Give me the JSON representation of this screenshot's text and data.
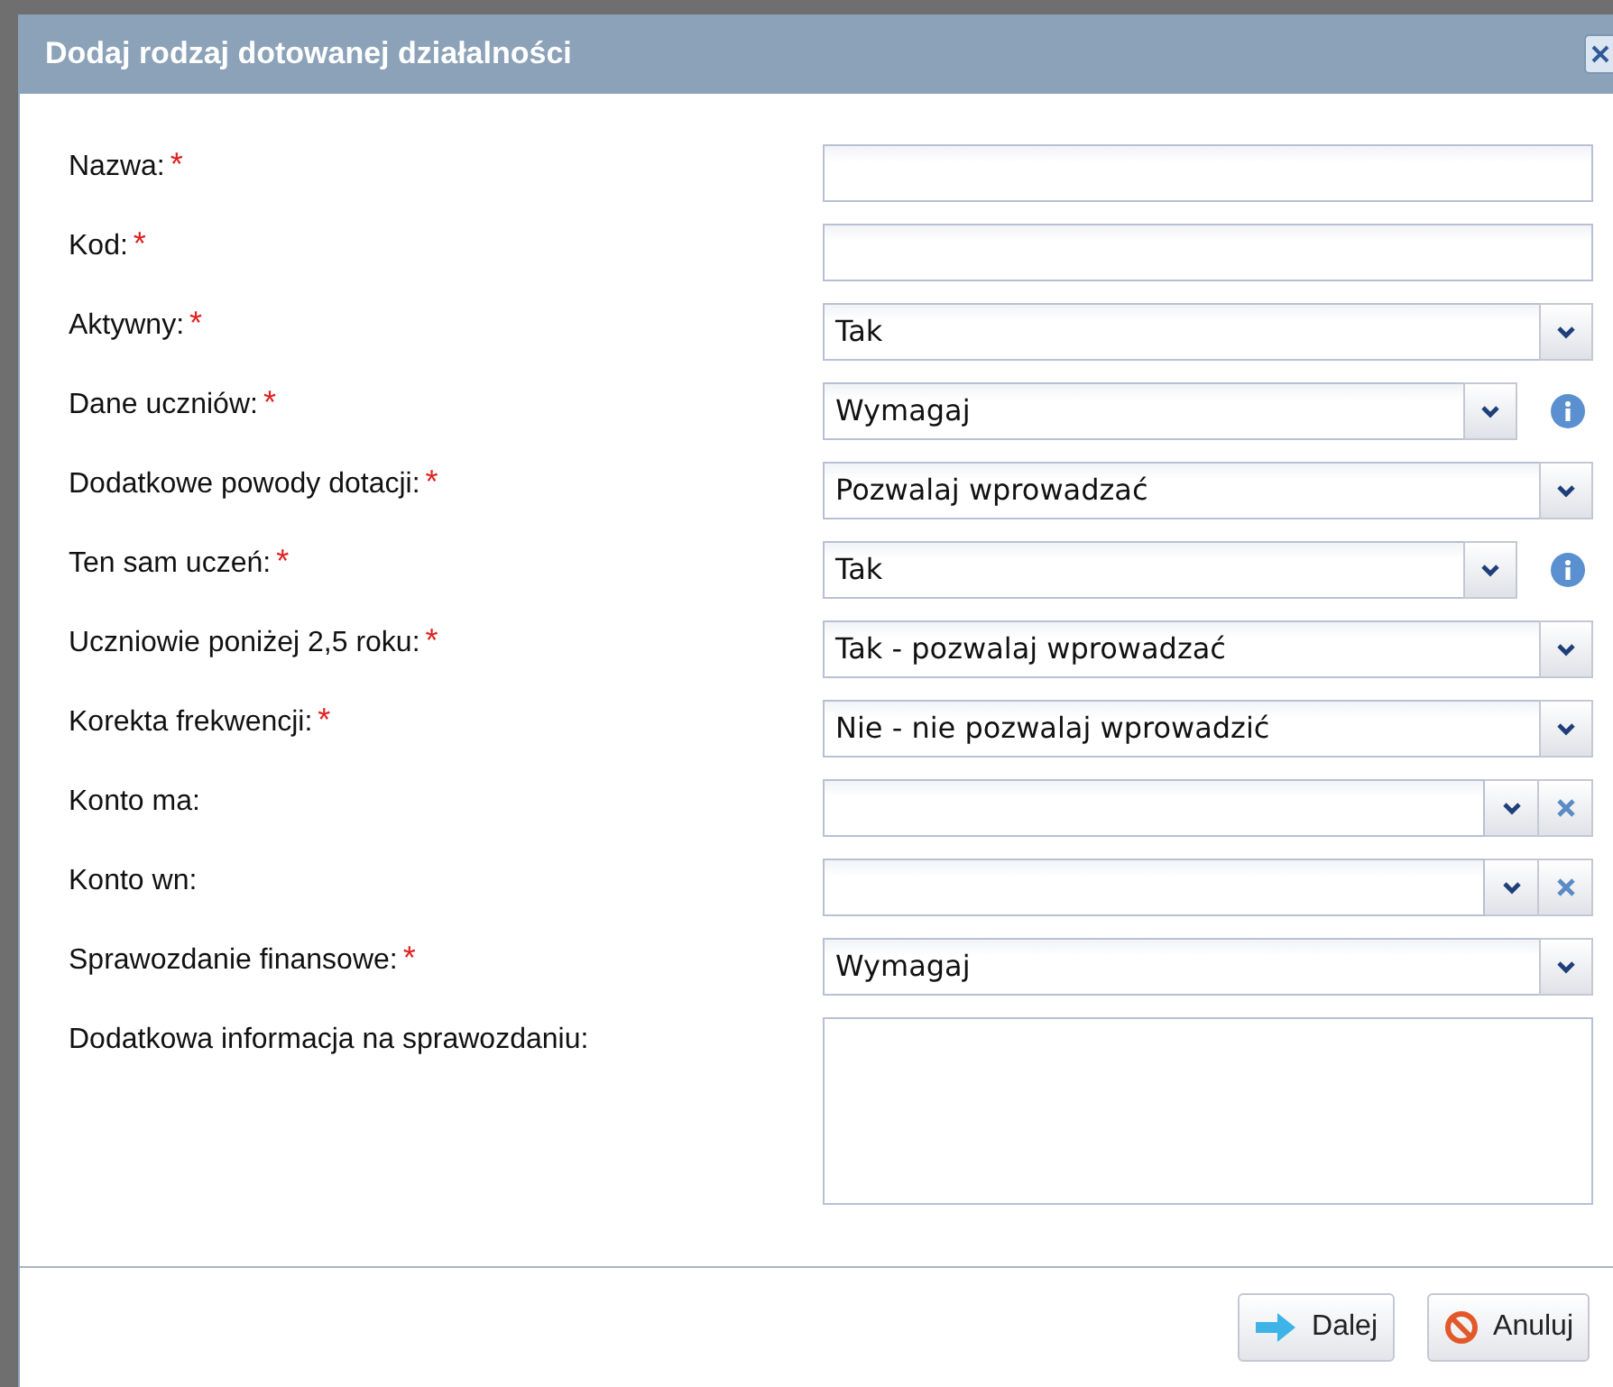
{
  "dialog": {
    "title": "Dodaj rodzaj dotowanej działalności"
  },
  "fields": [
    {
      "kind": "text",
      "label": "Nazwa:",
      "asterisk": "*"
    },
    {
      "kind": "text",
      "label": "Kod:",
      "asterisk": "*"
    },
    {
      "kind": "select",
      "label": "Aktywny:",
      "asterisk": "*",
      "value": "Tak"
    },
    {
      "kind": "select_info",
      "label": "Dane uczniów:",
      "asterisk": "*",
      "value": "Wymagaj"
    },
    {
      "kind": "select",
      "label": "Dodatkowe powody dotacji:",
      "asterisk": "*",
      "value": "Pozwalaj wprowadzać"
    },
    {
      "kind": "select_info",
      "label": "Ten sam uczeń:",
      "asterisk": "*",
      "value": "Tak"
    },
    {
      "kind": "select",
      "label": "Uczniowie poniżej 2,5 roku:",
      "asterisk": "*",
      "value": "Tak - pozwalaj wprowadzać"
    },
    {
      "kind": "select",
      "label": "Korekta frekwencji:",
      "asterisk": "*",
      "value": "Nie - nie pozwalaj wprowadzić"
    },
    {
      "kind": "combo",
      "label": "Konto ma:"
    },
    {
      "kind": "combo",
      "label": "Konto wn:"
    },
    {
      "kind": "select",
      "label": "Sprawozdanie finansowe:",
      "asterisk": "*",
      "value": "Wymagaj"
    },
    {
      "kind": "textarea",
      "label": "Dodatkowa informacja na sprawozdaniu:"
    }
  ],
  "buttons": [
    {
      "kind": "next",
      "label": "Dalej"
    },
    {
      "kind": "cancel",
      "label": "Anuluj"
    }
  ]
}
